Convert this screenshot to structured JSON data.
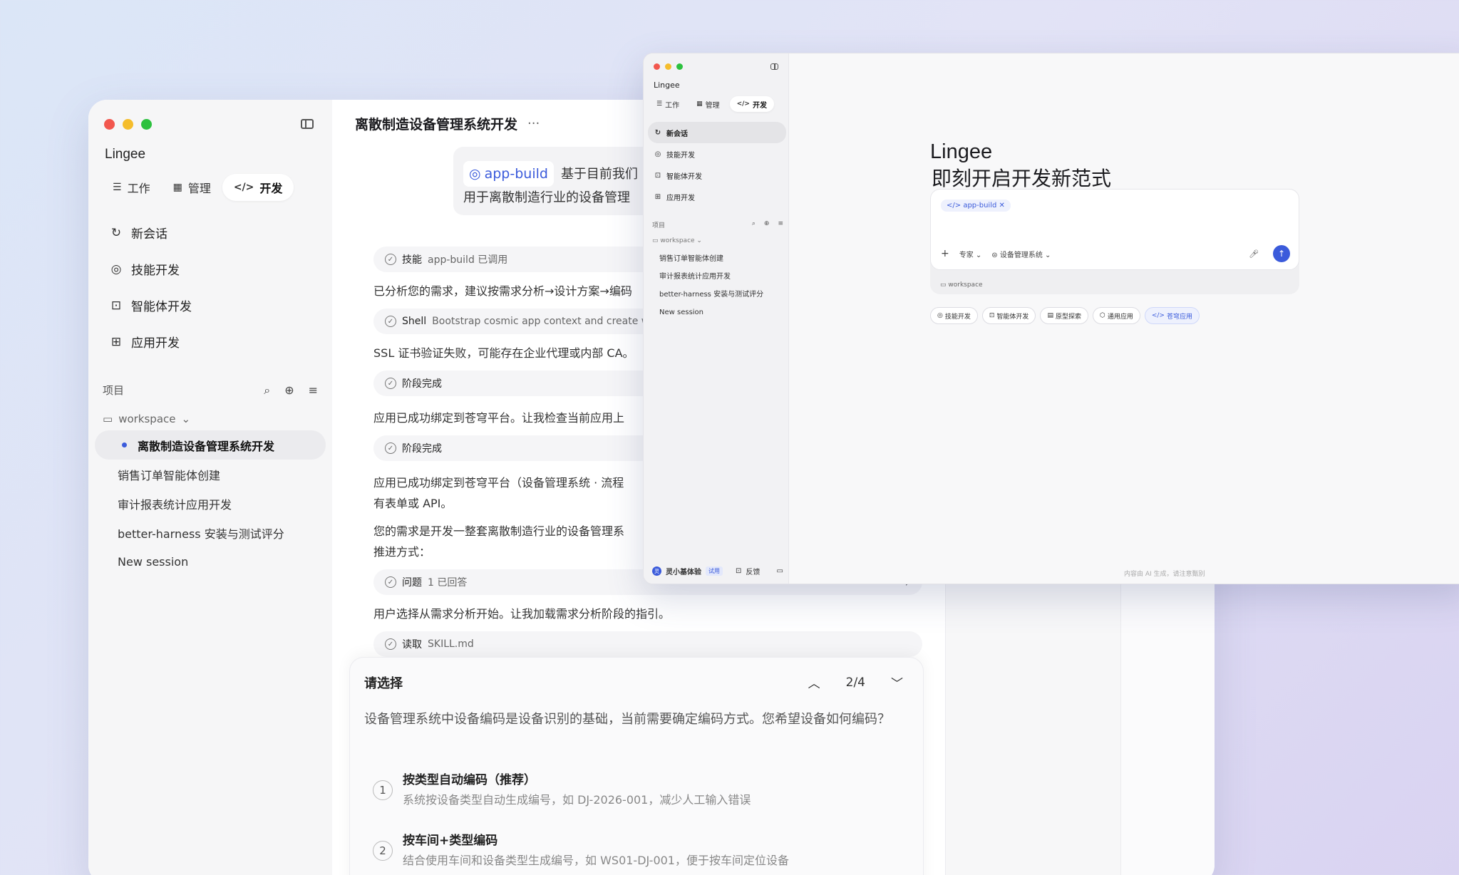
{
  "back": {
    "brand": "Lingee",
    "tabs": [
      {
        "label": "工作",
        "icon": "list-check-icon"
      },
      {
        "label": "管理",
        "icon": "building-icon"
      },
      {
        "label": "开发",
        "icon": "code-icon"
      }
    ],
    "nav": [
      {
        "label": "新会话",
        "icon": "new-chat-icon"
      },
      {
        "label": "技能开发",
        "icon": "skill-icon"
      },
      {
        "label": "智能体开发",
        "icon": "robot-icon"
      },
      {
        "label": "应用开发",
        "icon": "apps-grid-icon"
      }
    ],
    "projects_title": "项目",
    "workspace": "workspace",
    "sessions": [
      "离散制造设备管理系统开发",
      "销售订单智能体创建",
      "审计报表统计应用开发",
      "better-harness 安装与测试评分",
      "New session"
    ],
    "chat": {
      "title": "离散制造设备管理系统开发",
      "user_skill": "app-build",
      "user_text_line1": "基于目前我们",
      "user_text_line2": "用于离散制造行业的设备管理",
      "tool1_label": "技能",
      "tool1_text": "app-build 已调用",
      "msg1": "已分析您的需求，建议按需求分析→设计方案→编码",
      "tool2_label": "Shell",
      "tool2_text": "Bootstrap cosmic app context and create wo",
      "msg2": "SSL 证书验证失败，可能存在企业代理或内部 CA。",
      "stage1": "阶段完成",
      "msg3": "应用已成功绑定到苍穹平台。让我检查当前应用上",
      "stage2": "阶段完成",
      "msg4_line1": "应用已成功绑定到苍穹平台（设备管理系统 · 流程",
      "msg4_line2": "有表单或 API。",
      "msg5_line1": "您的需求是开发一整套离散制造行业的设备管理系",
      "msg5_line2": "推进方式：",
      "question_label": "问题",
      "question_status": "1 已回答",
      "msg6": "用户选择从需求分析开始。让我加载需求分析阶段的指引。",
      "read_label": "读取",
      "read_file": "SKILL.md"
    },
    "ask": {
      "title": "请选择",
      "pager": "2/4",
      "question": "设备管理系统中设备编码是设备识别的基础，当前需要确定编码方式。您希望设备如何编码？",
      "options": [
        {
          "num": "1",
          "title": "按类型自动编码（推荐）",
          "desc": "系统按设备类型自动生成编号，如 DJ-2026-001，减少人工输入错误"
        },
        {
          "num": "2",
          "title": "按车间+类型编码",
          "desc": "结合使用车间和设备类型生成编号，如 WS01-DJ-001，便于按车间定位设备"
        }
      ]
    }
  },
  "front": {
    "brand": "Lingee",
    "tabs": [
      "工作",
      "管理",
      "开发"
    ],
    "nav": [
      "新会话",
      "技能开发",
      "智能体开发",
      "应用开发"
    ],
    "projects_title": "项目",
    "workspace": "workspace",
    "sessions": [
      "销售订单智能体创建",
      "审计报表统计应用开发",
      "better-harness 安装与测试评分",
      "New session"
    ],
    "user_name": "灵小基体验",
    "user_badge": "试用",
    "feedback": "反馈",
    "logo": "Lingee",
    "tagline": "即刻开启开发新范式",
    "composer_chip": "app-build",
    "mode": "专家",
    "system": "设备管理系统",
    "composer_workspace": "workspace",
    "quick": [
      "技能开发",
      "智能体开发",
      "原型探索",
      "通用应用",
      "苍穹应用"
    ],
    "footer": "内容由 AI 生成，请注意甄别"
  },
  "colors": {
    "accent": "#3b5bdb",
    "bg_gradient_start": "#dbe6f7",
    "bg_gradient_end": "#d9d3f1"
  }
}
